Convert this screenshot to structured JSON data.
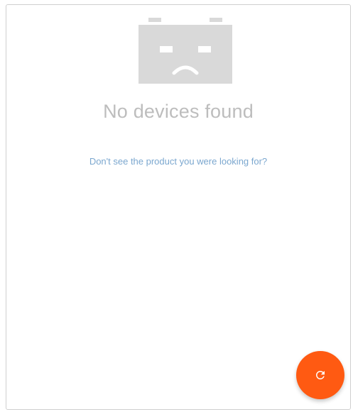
{
  "empty_state": {
    "title": "No devices found",
    "help_link": "Don't see the product you were looking for?",
    "illustration_icon": "sad-device-icon"
  },
  "fab": {
    "icon": "refresh-icon",
    "color": "#ff5a12"
  },
  "colors": {
    "title_text": "#bdbdbd",
    "link_text": "#7ba7cf",
    "illustration": "#d9d9d9"
  }
}
